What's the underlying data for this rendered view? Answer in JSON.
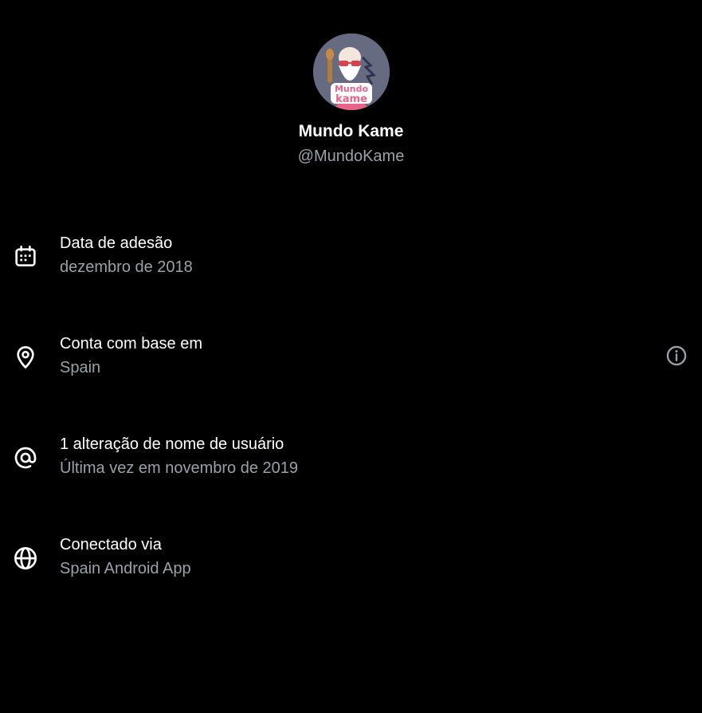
{
  "profile": {
    "display_name": "Mundo Kame",
    "handle": "@MundoKame",
    "avatar_text_top": "Mundo",
    "avatar_text_bottom": "kame"
  },
  "rows": [
    {
      "icon": "calendar-icon",
      "label": "Data de adesão",
      "value": "dezembro de 2018"
    },
    {
      "icon": "location-pin-icon",
      "label": "Conta com base em",
      "value": "Spain",
      "action_icon": "info-icon"
    },
    {
      "icon": "at-sign-icon",
      "label": "1 alteração de nome de usuário",
      "value": "Última vez em novembro de 2019"
    },
    {
      "icon": "globe-icon",
      "label": "Conectado via",
      "value": "Spain Android App"
    }
  ],
  "colors": {
    "background": "#000000",
    "primary_text": "#ffffff",
    "secondary_text": "#9aa1a8",
    "avatar_accent": "#e8638a"
  }
}
